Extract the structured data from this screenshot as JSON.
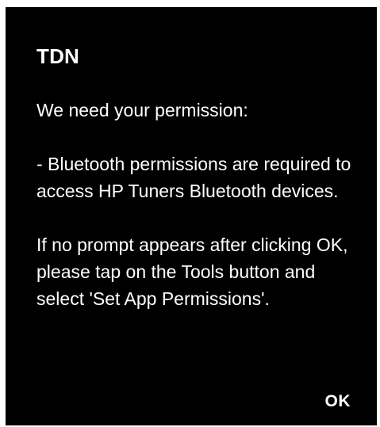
{
  "dialog": {
    "title": "TDN",
    "paragraphs": [
      "We need your permission:",
      "- Bluetooth permissions are required to access HP Tuners Bluetooth devices.",
      "If no prompt appears after clicking OK, please tap on the Tools button and select 'Set App Permissions'."
    ],
    "ok_label": "OK"
  },
  "colors": {
    "dialog_background": "#000000",
    "text": "#ffffff",
    "page_background": "#ffffff"
  }
}
